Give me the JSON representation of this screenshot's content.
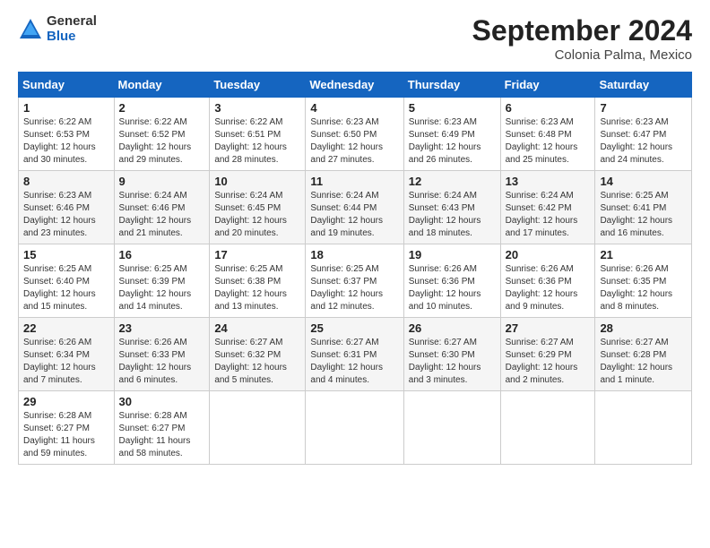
{
  "logo": {
    "general": "General",
    "blue": "Blue"
  },
  "title": "September 2024",
  "subtitle": "Colonia Palma, Mexico",
  "days_of_week": [
    "Sunday",
    "Monday",
    "Tuesday",
    "Wednesday",
    "Thursday",
    "Friday",
    "Saturday"
  ],
  "weeks": [
    [
      {
        "day": "1",
        "info": "Sunrise: 6:22 AM\nSunset: 6:53 PM\nDaylight: 12 hours\nand 30 minutes."
      },
      {
        "day": "2",
        "info": "Sunrise: 6:22 AM\nSunset: 6:52 PM\nDaylight: 12 hours\nand 29 minutes."
      },
      {
        "day": "3",
        "info": "Sunrise: 6:22 AM\nSunset: 6:51 PM\nDaylight: 12 hours\nand 28 minutes."
      },
      {
        "day": "4",
        "info": "Sunrise: 6:23 AM\nSunset: 6:50 PM\nDaylight: 12 hours\nand 27 minutes."
      },
      {
        "day": "5",
        "info": "Sunrise: 6:23 AM\nSunset: 6:49 PM\nDaylight: 12 hours\nand 26 minutes."
      },
      {
        "day": "6",
        "info": "Sunrise: 6:23 AM\nSunset: 6:48 PM\nDaylight: 12 hours\nand 25 minutes."
      },
      {
        "day": "7",
        "info": "Sunrise: 6:23 AM\nSunset: 6:47 PM\nDaylight: 12 hours\nand 24 minutes."
      }
    ],
    [
      {
        "day": "8",
        "info": "Sunrise: 6:23 AM\nSunset: 6:46 PM\nDaylight: 12 hours\nand 23 minutes."
      },
      {
        "day": "9",
        "info": "Sunrise: 6:24 AM\nSunset: 6:46 PM\nDaylight: 12 hours\nand 21 minutes."
      },
      {
        "day": "10",
        "info": "Sunrise: 6:24 AM\nSunset: 6:45 PM\nDaylight: 12 hours\nand 20 minutes."
      },
      {
        "day": "11",
        "info": "Sunrise: 6:24 AM\nSunset: 6:44 PM\nDaylight: 12 hours\nand 19 minutes."
      },
      {
        "day": "12",
        "info": "Sunrise: 6:24 AM\nSunset: 6:43 PM\nDaylight: 12 hours\nand 18 minutes."
      },
      {
        "day": "13",
        "info": "Sunrise: 6:24 AM\nSunset: 6:42 PM\nDaylight: 12 hours\nand 17 minutes."
      },
      {
        "day": "14",
        "info": "Sunrise: 6:25 AM\nSunset: 6:41 PM\nDaylight: 12 hours\nand 16 minutes."
      }
    ],
    [
      {
        "day": "15",
        "info": "Sunrise: 6:25 AM\nSunset: 6:40 PM\nDaylight: 12 hours\nand 15 minutes."
      },
      {
        "day": "16",
        "info": "Sunrise: 6:25 AM\nSunset: 6:39 PM\nDaylight: 12 hours\nand 14 minutes."
      },
      {
        "day": "17",
        "info": "Sunrise: 6:25 AM\nSunset: 6:38 PM\nDaylight: 12 hours\nand 13 minutes."
      },
      {
        "day": "18",
        "info": "Sunrise: 6:25 AM\nSunset: 6:37 PM\nDaylight: 12 hours\nand 12 minutes."
      },
      {
        "day": "19",
        "info": "Sunrise: 6:26 AM\nSunset: 6:36 PM\nDaylight: 12 hours\nand 10 minutes."
      },
      {
        "day": "20",
        "info": "Sunrise: 6:26 AM\nSunset: 6:36 PM\nDaylight: 12 hours\nand 9 minutes."
      },
      {
        "day": "21",
        "info": "Sunrise: 6:26 AM\nSunset: 6:35 PM\nDaylight: 12 hours\nand 8 minutes."
      }
    ],
    [
      {
        "day": "22",
        "info": "Sunrise: 6:26 AM\nSunset: 6:34 PM\nDaylight: 12 hours\nand 7 minutes."
      },
      {
        "day": "23",
        "info": "Sunrise: 6:26 AM\nSunset: 6:33 PM\nDaylight: 12 hours\nand 6 minutes."
      },
      {
        "day": "24",
        "info": "Sunrise: 6:27 AM\nSunset: 6:32 PM\nDaylight: 12 hours\nand 5 minutes."
      },
      {
        "day": "25",
        "info": "Sunrise: 6:27 AM\nSunset: 6:31 PM\nDaylight: 12 hours\nand 4 minutes."
      },
      {
        "day": "26",
        "info": "Sunrise: 6:27 AM\nSunset: 6:30 PM\nDaylight: 12 hours\nand 3 minutes."
      },
      {
        "day": "27",
        "info": "Sunrise: 6:27 AM\nSunset: 6:29 PM\nDaylight: 12 hours\nand 2 minutes."
      },
      {
        "day": "28",
        "info": "Sunrise: 6:27 AM\nSunset: 6:28 PM\nDaylight: 12 hours\nand 1 minute."
      }
    ],
    [
      {
        "day": "29",
        "info": "Sunrise: 6:28 AM\nSunset: 6:27 PM\nDaylight: 11 hours\nand 59 minutes."
      },
      {
        "day": "30",
        "info": "Sunrise: 6:28 AM\nSunset: 6:27 PM\nDaylight: 11 hours\nand 58 minutes."
      },
      {
        "day": "",
        "info": ""
      },
      {
        "day": "",
        "info": ""
      },
      {
        "day": "",
        "info": ""
      },
      {
        "day": "",
        "info": ""
      },
      {
        "day": "",
        "info": ""
      }
    ]
  ]
}
